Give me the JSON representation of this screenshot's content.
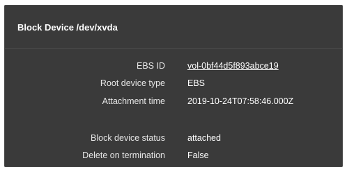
{
  "panel": {
    "title": "Block Device /dev/xvda"
  },
  "details": {
    "ebs_id_label": "EBS ID",
    "ebs_id_value": "vol-0bf44d5f893abce19",
    "root_device_type_label": "Root device type",
    "root_device_type_value": "EBS",
    "attachment_time_label": "Attachment time",
    "attachment_time_value": "2019-10-24T07:58:46.000Z",
    "block_device_status_label": "Block device status",
    "block_device_status_value": "attached",
    "delete_on_termination_label": "Delete on termination",
    "delete_on_termination_value": "False"
  },
  "colors": {
    "panel_background": "#3a3a3a",
    "text": "#ffffff",
    "label_text": "#e6e6e6"
  }
}
